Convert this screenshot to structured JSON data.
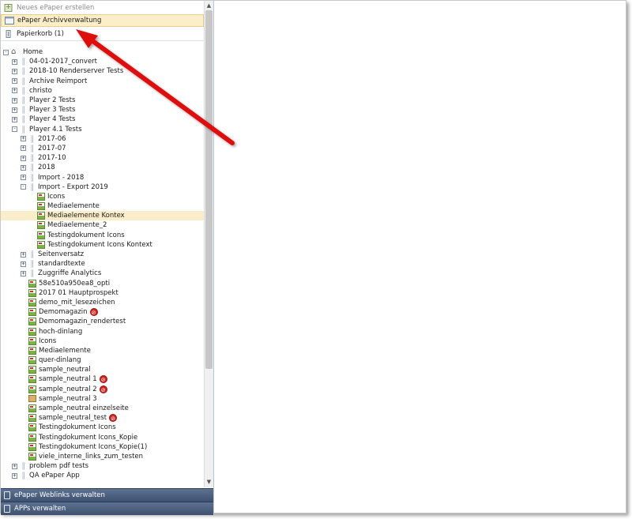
{
  "panel": {
    "top_items": [
      {
        "label": "Neues ePaper erstellen",
        "icon": "new-epaper-icon"
      },
      {
        "label": "ePaper Archivverwaltung",
        "icon": "archive-icon"
      },
      {
        "label": "Papierkorb (1)",
        "icon": "trash-icon"
      }
    ],
    "tree": [
      {
        "label": "Home",
        "level": 0,
        "expander": "-",
        "icon": "home"
      },
      {
        "label": "04-01-2017_convert",
        "level": 1,
        "expander": "+",
        "icon": "folder"
      },
      {
        "label": "2018-10 Renderserver Tests",
        "level": 1,
        "expander": "+",
        "icon": "folder"
      },
      {
        "label": "Archive Reimport",
        "level": 1,
        "expander": "+",
        "icon": "folder"
      },
      {
        "label": "christo",
        "level": 1,
        "expander": "+",
        "icon": "folder"
      },
      {
        "label": "Player 2 Tests",
        "level": 1,
        "expander": "+",
        "icon": "folder"
      },
      {
        "label": "Player 3 Tests",
        "level": 1,
        "expander": "+",
        "icon": "folder"
      },
      {
        "label": "Player 4 Tests",
        "level": 1,
        "expander": "+",
        "icon": "folder"
      },
      {
        "label": "Player 4.1 Tests",
        "level": 1,
        "expander": "-",
        "icon": "folder"
      },
      {
        "label": "2017-06",
        "level": 2,
        "expander": "+",
        "icon": "folder"
      },
      {
        "label": "2017-07",
        "level": 2,
        "expander": "+",
        "icon": "folder"
      },
      {
        "label": "2017-10",
        "level": 2,
        "expander": "+",
        "icon": "folder"
      },
      {
        "label": "2018",
        "level": 2,
        "expander": "+",
        "icon": "folder"
      },
      {
        "label": "Import - 2018",
        "level": 2,
        "expander": "+",
        "icon": "folder"
      },
      {
        "label": "Import - Export 2019",
        "level": 2,
        "expander": "-",
        "icon": "folder"
      },
      {
        "label": "Icons",
        "level": 3,
        "expander": "",
        "icon": "doc"
      },
      {
        "label": "Mediaelemente",
        "level": 3,
        "expander": "",
        "icon": "doc"
      },
      {
        "label": "Mediaelemente Kontex",
        "level": 3,
        "expander": "",
        "icon": "doc",
        "selected": true
      },
      {
        "label": "Mediaelemente_2",
        "level": 3,
        "expander": "",
        "icon": "doc"
      },
      {
        "label": "Testingdokument Icons",
        "level": 3,
        "expander": "",
        "icon": "doc"
      },
      {
        "label": "Testingdokument Icons Kontext",
        "level": 3,
        "expander": "",
        "icon": "doc"
      },
      {
        "label": "Seitenversatz",
        "level": 2,
        "expander": "+",
        "icon": "folder"
      },
      {
        "label": "standardtexte",
        "level": 2,
        "expander": "+",
        "icon": "folder"
      },
      {
        "label": "Zuggriffe Analytics",
        "level": 2,
        "expander": "+",
        "icon": "folder"
      },
      {
        "label": "58e510a950ea8_opti",
        "level": 2,
        "expander": "",
        "icon": "doc"
      },
      {
        "label": "2017 01 Hauptprospekt",
        "level": 2,
        "expander": "",
        "icon": "doc"
      },
      {
        "label": "demo_mit_lesezeichen",
        "level": 2,
        "expander": "",
        "icon": "doc"
      },
      {
        "label": "Demomagazin",
        "level": 2,
        "expander": "",
        "icon": "doc",
        "badge": true
      },
      {
        "label": "Demomagazin_rendertest",
        "level": 2,
        "expander": "",
        "icon": "doc"
      },
      {
        "label": "hoch-dinlang",
        "level": 2,
        "expander": "",
        "icon": "doc"
      },
      {
        "label": "Icons",
        "level": 2,
        "expander": "",
        "icon": "doc"
      },
      {
        "label": "Mediaelemente",
        "level": 2,
        "expander": "",
        "icon": "doc"
      },
      {
        "label": "quer-dinlang",
        "level": 2,
        "expander": "",
        "icon": "doc"
      },
      {
        "label": "sample_neutral",
        "level": 2,
        "expander": "",
        "icon": "doc"
      },
      {
        "label": "sample_neutral 1",
        "level": 2,
        "expander": "",
        "icon": "doc",
        "badge": true
      },
      {
        "label": "sample_neutral 2",
        "level": 2,
        "expander": "",
        "icon": "doc",
        "badge": true
      },
      {
        "label": "sample_neutral 3",
        "level": 2,
        "expander": "",
        "icon": "box"
      },
      {
        "label": "sample_neutral einzelseite",
        "level": 2,
        "expander": "",
        "icon": "doc"
      },
      {
        "label": "sample_neutral_test",
        "level": 2,
        "expander": "",
        "icon": "doc",
        "badge": true
      },
      {
        "label": "Testingdokument Icons",
        "level": 2,
        "expander": "",
        "icon": "doc"
      },
      {
        "label": "Testingdokument Icons_Kopie",
        "level": 2,
        "expander": "",
        "icon": "doc"
      },
      {
        "label": "Testingdokument Icons_Kopie(1)",
        "level": 2,
        "expander": "",
        "icon": "doc"
      },
      {
        "label": "viele_interne_links_zum_testen",
        "level": 2,
        "expander": "",
        "icon": "doc"
      },
      {
        "label": "problem pdf tests",
        "level": 1,
        "expander": "+",
        "icon": "folder"
      },
      {
        "label": "QA ePaper App",
        "level": 1,
        "expander": "+",
        "icon": "folder"
      }
    ],
    "bottom_items": [
      {
        "label": "ePaper Weblinks verwalten",
        "icon": "weblinks-icon"
      },
      {
        "label": "APPs verwalten",
        "icon": "apps-icon"
      }
    ]
  },
  "colors": {
    "selection": "#faedc9",
    "bottom_bar": "#4a5d7e",
    "annotation_arrow": "#e01010"
  }
}
